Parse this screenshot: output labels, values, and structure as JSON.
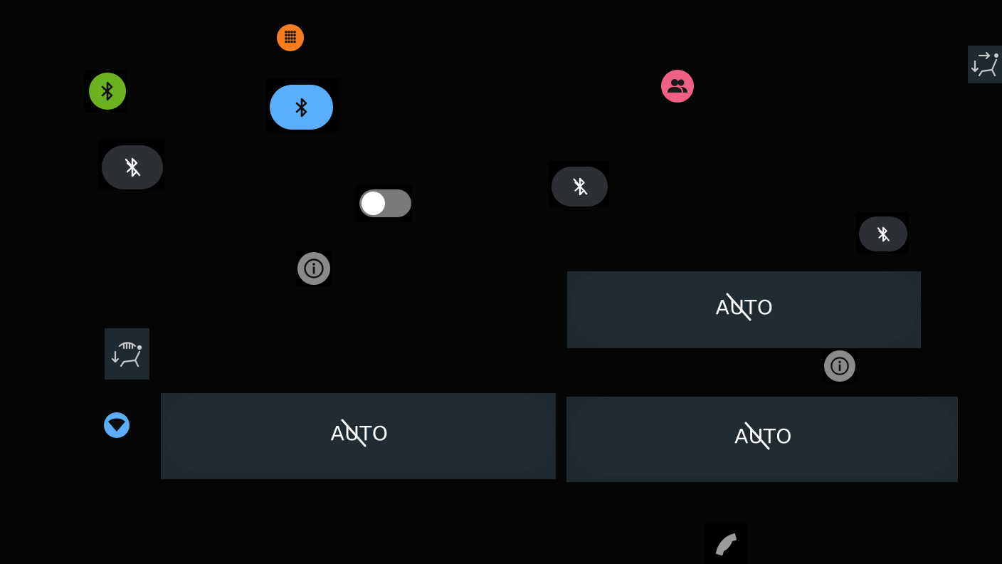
{
  "colors": {
    "background": "#050505",
    "orange": "#f57c1f",
    "green": "#6ab31e",
    "blue": "#5aaefc",
    "pink": "#ef5f86",
    "dark_pill": "#2c2f33",
    "toggle_track": "#7a7a7a",
    "toggle_knob": "#ffffff",
    "info_grey": "#8a8a8a",
    "panel": "#1f2a30",
    "auto_pill": "#222b31"
  },
  "icons": {
    "apps": "apps-grid-icon",
    "bluetooth": "bluetooth-icon",
    "bluetooth_disabled": "bluetooth-disabled-icon",
    "people": "people-icon",
    "seat_recline": "seat-recline-icon",
    "seat_heat": "seat-heat-icon",
    "wifi": "wifi-icon",
    "info": "info-icon",
    "phone": "phone-icon"
  },
  "auto_buttons": [
    {
      "label": "AUTO"
    },
    {
      "label": "AUTO"
    },
    {
      "label": "AUTO"
    }
  ]
}
